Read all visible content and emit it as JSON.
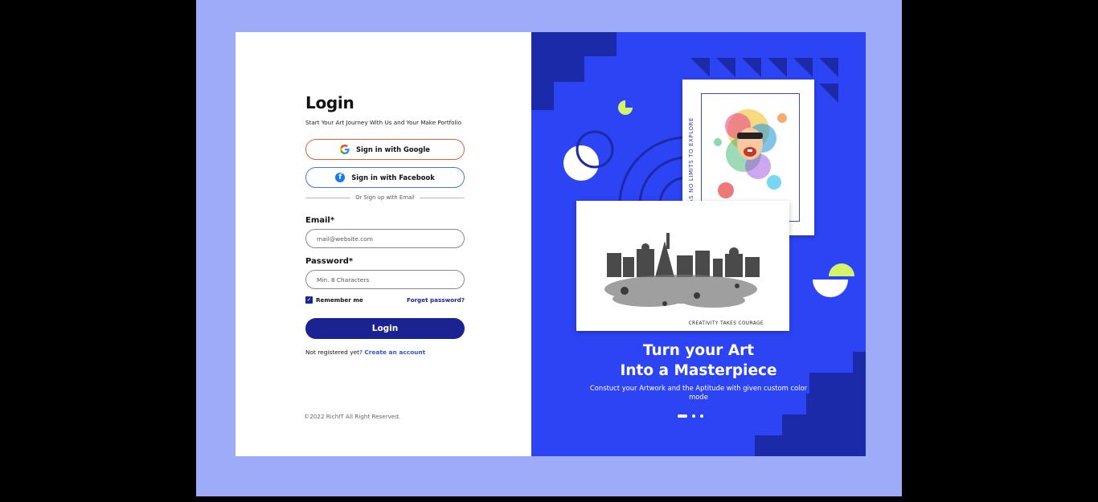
{
  "login": {
    "title": "Login",
    "subtitle": "Start Your Art Journey With Us and Your Make Portfolio",
    "google_label": "Sign in with Google",
    "facebook_label": "Sign in with Facebook",
    "divider_text": "Or Sign up with Email",
    "email_label": "Email*",
    "email_placeholder": "mail@website.com",
    "password_label": "Password*",
    "password_placeholder": "Min. 8 Characters",
    "remember_label": "Remember me",
    "remember_checked": true,
    "forgot_label": "Forget password?",
    "submit_label": "Login",
    "register_prompt": "Not registered yet?",
    "register_link": "Create an account",
    "copyright": "©2022 RichIT All Right Reserved."
  },
  "promo": {
    "portrait_caption": "ART HAS NO LIMITS TO EXPLORE",
    "landscape_caption": "CREATIVITY TAKES COURAGE",
    "headline_line1": "Turn your Art",
    "headline_line2": "Into a Masterpiece",
    "tagline": "Constuct your Artwork and the Aptitude with given custom color mode",
    "carousel_count": 3,
    "carousel_active": 0
  },
  "colors": {
    "stage_bg": "#9dabf8",
    "panel_blue": "#2d44f4",
    "dark_blue": "#1b2292",
    "google_border": "#e8613a",
    "facebook_border": "#3d79e6",
    "lime_accent": "#d4f56a"
  }
}
